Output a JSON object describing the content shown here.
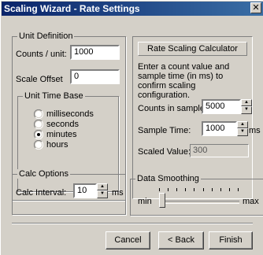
{
  "window": {
    "title": "Scaling Wizard - Rate Settings",
    "close_glyph": "✕"
  },
  "unit_definition": {
    "legend": "Unit Definition",
    "counts_label": "Counts / unit:",
    "counts_value": "1000",
    "offset_label": "Scale Offset",
    "offset_value": "0",
    "time_base": {
      "legend": "Unit Time Base",
      "options": [
        "milliseconds",
        "seconds",
        "minutes",
        "hours"
      ],
      "selected": "minutes"
    }
  },
  "calculator": {
    "title": "Rate Scaling Calculator",
    "description": "Enter a count value and sample time (in ms) to confirm scaling configuration.",
    "counts_label": "Counts in sample:",
    "counts_value": "5000",
    "time_label": "Sample Time:",
    "time_value": "1000",
    "time_unit": "ms",
    "scaled_label": "Scaled Value:",
    "scaled_value": "300"
  },
  "calc_options": {
    "legend": "Calc Options",
    "interval_label": "Calc Interval:",
    "interval_value": "10",
    "interval_unit": "ms"
  },
  "smoothing": {
    "legend": "Data Smoothing",
    "min_label": "min",
    "max_label": "max",
    "tick_count": 10,
    "level": 0
  },
  "buttons": {
    "cancel": "Cancel",
    "back": "< Back",
    "finish": "Finish"
  }
}
